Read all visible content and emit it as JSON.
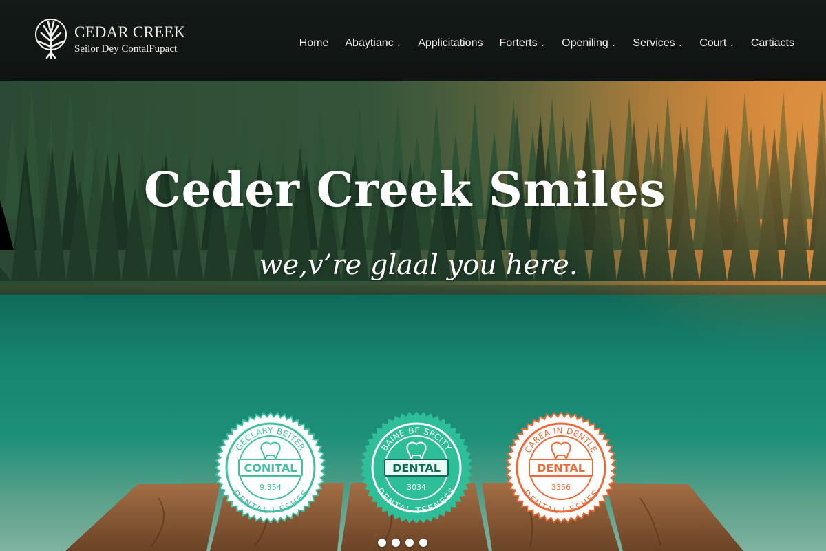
{
  "brand": {
    "title": "CEDAR CREEK",
    "tagline": "Seilor Dey ContalFupact",
    "logo_icon": "tree-icon"
  },
  "nav": {
    "items": [
      {
        "label": "Home",
        "dropdown": false
      },
      {
        "label": "Abaytianc",
        "dropdown": true
      },
      {
        "label": "Applicitations",
        "dropdown": false
      },
      {
        "label": "Forterts",
        "dropdown": true
      },
      {
        "label": "Openiling",
        "dropdown": true
      },
      {
        "label": "Services",
        "dropdown": true
      },
      {
        "label": "Court",
        "dropdown": true
      },
      {
        "label": "Cartiacts",
        "dropdown": false
      }
    ],
    "chevron_icon": "chevron-down-icon"
  },
  "hero": {
    "title": "Ceder Creek Smiles",
    "subtitle": "we,v’re glaal you here."
  },
  "badges": [
    {
      "ring_text": "GECLARY BEITER",
      "center": "CONITAL",
      "number": "9.354",
      "bottom_text": "DENTAL I ESHES",
      "color": "#3fbfa3",
      "style": "outline",
      "icon": "tooth-icon"
    },
    {
      "ring_text": "BAINE BE SPCITY",
      "center": "DENTAL",
      "number": "3034",
      "bottom_text": "DENTAL TSENESS",
      "color": "#2fbf98",
      "style": "filled",
      "icon": "tooth-icon"
    },
    {
      "ring_text": "CAREA IN DENTLE",
      "center": "DENTAL",
      "number": "3356",
      "bottom_text": "DENTAL I ESHES",
      "color": "#ee6a36",
      "style": "outline",
      "icon": "tooth-icon"
    }
  ],
  "carousel": {
    "slides": 4,
    "active": 1
  },
  "colors": {
    "header_bg": "#121815",
    "teal": "#2fbf98",
    "orange": "#ee6a36",
    "lake": "#178470"
  }
}
